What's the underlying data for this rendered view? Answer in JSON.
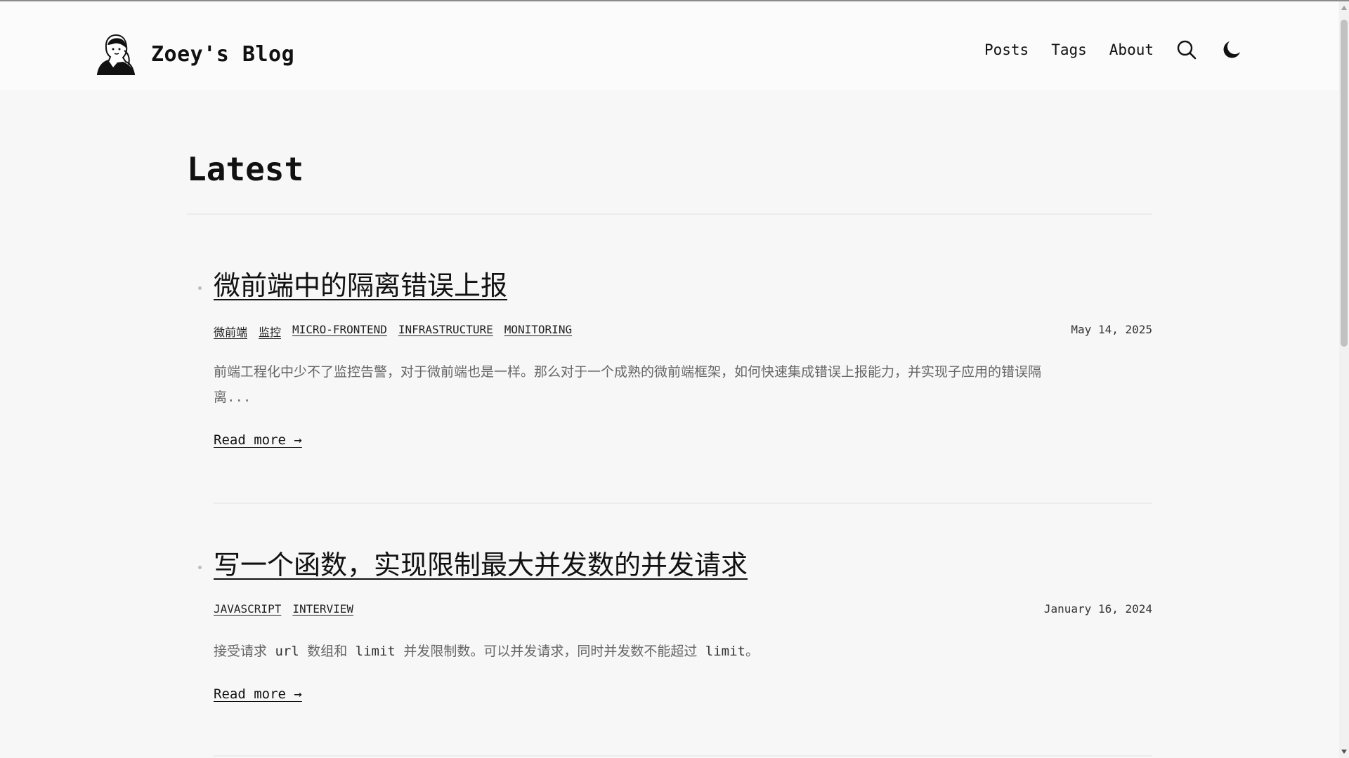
{
  "site": {
    "title": "Zoey's Blog"
  },
  "nav": {
    "items": [
      {
        "label": "Posts"
      },
      {
        "label": "Tags"
      },
      {
        "label": "About"
      }
    ],
    "search_icon": "search-icon",
    "theme_icon": "moon-icon"
  },
  "main": {
    "heading": "Latest",
    "posts": [
      {
        "title": "微前端中的隔离错误上报",
        "tags": [
          "微前端",
          "监控",
          "MICRO-FRONTEND",
          "INFRASTRUCTURE",
          "MONITORING"
        ],
        "date": "May 14, 2025",
        "summary_line1": "前端工程化中少不了监控告警，对于微前端也是一样。那么对于一个成熟的微前端框架，如何快速集成错误上报能力，并实现子应用的错误隔",
        "summary_line2": "离...",
        "read_more": "Read more →"
      },
      {
        "title": "写一个函数，实现限制最大并发数的并发请求",
        "tags": [
          "JAVASCRIPT",
          "INTERVIEW"
        ],
        "date": "January 16, 2024",
        "summary_parts": [
          "接受请求 ",
          "url",
          " 数组和 ",
          "limit",
          " 并发限制数。可以并发请求，同时并发数不能超过 ",
          "limit",
          "。"
        ],
        "read_more": "Read more →"
      }
    ]
  },
  "colors": {
    "background": "#f7f7f7",
    "header_bg": "#fbfbfb",
    "text": "#111111",
    "muted_text": "#666666",
    "rule": "#ececec"
  }
}
